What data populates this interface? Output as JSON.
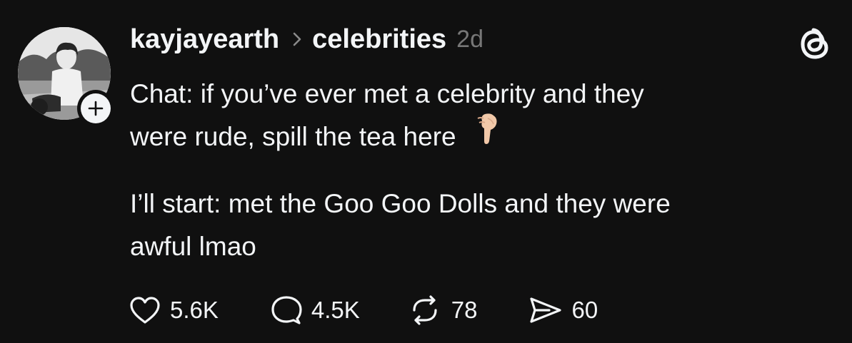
{
  "post": {
    "author": {
      "username": "kayjayearth",
      "avatar_icon": "person-photo"
    },
    "community": "celebrities",
    "time_ago": "2d",
    "text_line1": "Chat: if you’ve ever met a celebrity and they",
    "text_line2": "were rude, spill the tea here",
    "emoji": "backhand-index-pointing-down-emoji",
    "text_para2_line1": "I’ll start: met the Goo Goo Dolls and they were",
    "text_para2_line2": "awful lmao"
  },
  "actions": {
    "likes": "5.6K",
    "replies": "4.5K",
    "reposts": "78",
    "shares": "60"
  },
  "colors": {
    "background": "#101010",
    "text": "#f3f5f7",
    "muted": "#777777"
  }
}
